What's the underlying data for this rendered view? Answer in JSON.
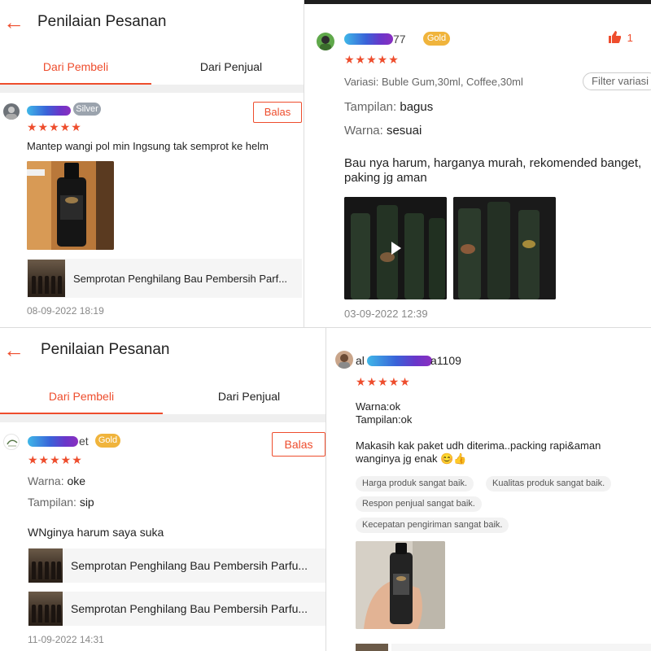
{
  "colors": {
    "accent": "#ee4d2d",
    "star": "#ee4d2d",
    "gold_badge": "#f0b43c",
    "silver_badge": "#9ba3ad"
  },
  "icons": {
    "back": "arrow-left-icon",
    "star": "star-icon",
    "like": "thumbs-up-icon",
    "play": "play-icon"
  },
  "panel1": {
    "title": "Penilaian Pesanan",
    "tabs": [
      "Dari Pembeli",
      "Dari Penjual"
    ],
    "review": {
      "badge": "Silver",
      "stars": "★★★★★",
      "reply_button": "Balas",
      "comment": "Mantep wangi pol min Ingsung tak semprot ke helm",
      "product": "Semprotan Penghilang Bau Pembersih Parf...",
      "date": "08-09-2022 18:19"
    }
  },
  "panel2": {
    "review": {
      "username_suffix": "77",
      "badge": "Gold",
      "like_count": "1",
      "stars": "★★★★★",
      "variation": "Variasi: Buble Gum,30ml, Coffee,30ml",
      "filter": "Filter variasi",
      "tampilan_label": "Tampilan:",
      "tampilan_value": "bagus",
      "warna_label": "Warna:",
      "warna_value": "sesuai",
      "comment_line1": "Bau nya harum, harganya murah, rekomended banget,",
      "comment_line2": "paking jg aman",
      "date": "03-09-2022 12:39"
    }
  },
  "panel3": {
    "title": "Penilaian Pesanan",
    "tabs": [
      "Dari Pembeli",
      "Dari Penjual"
    ],
    "review": {
      "username_suffix": "et",
      "badge": "Gold",
      "stars": "★★★★★",
      "reply_button": "Balas",
      "warna_label": "Warna:",
      "warna_value": "oke",
      "tampilan_label": "Tampilan:",
      "tampilan_value": "sip",
      "comment": "WNginya harum saya suka",
      "products": [
        "Semprotan Penghilang Bau Pembersih Parfu...",
        "Semprotan Penghilang Bau Pembersih Parfu..."
      ],
      "date": "11-09-2022 14:31"
    }
  },
  "panel4": {
    "review": {
      "username_prefix": "al",
      "username_suffix": "a1109",
      "stars": "★★★★★",
      "warna": "Warna:ok",
      "tampilan": "Tampilan:ok",
      "comment_line1": "Makasih kak paket udh diterima..packing rapi&aman",
      "comment_line2": "wanginya jg enak 😊👍",
      "tags": [
        "Harga produk sangat baik.",
        "Kualitas produk sangat baik.",
        "Respon penjual sangat baik.",
        "Kecepatan pengiriman sangat baik."
      ]
    }
  }
}
